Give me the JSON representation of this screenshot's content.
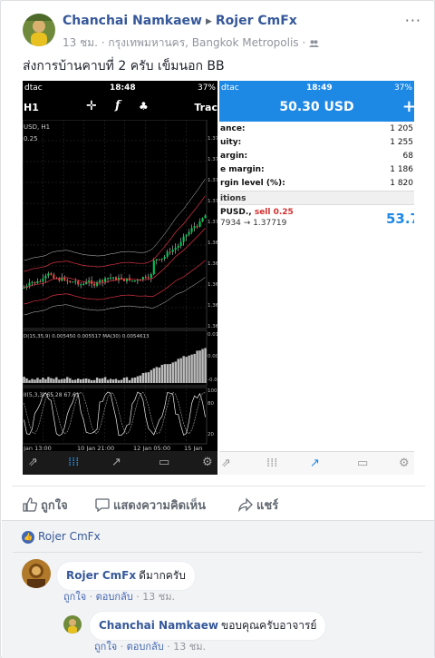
{
  "post": {
    "author": "Chanchai Namkaew",
    "target_group": "Rojer CmFx",
    "time": "13 ชม.",
    "location": "กรุงเทพมหานคร, Bangkok Metropolis",
    "text": "ส่งการบ้านคาบที่ 2 ครับ เข็มนอก BB"
  },
  "left_screenshot": {
    "carrier": "dtac",
    "clock": "18:48",
    "battery": "37%",
    "symbol_label": "USD, H1",
    "price_label": "0.25",
    "timeframe": "H1",
    "trade_label": "Trac",
    "indicator1_label": "D(15,35,9) 0.005450 0.005517 MA(30) 0.0054613",
    "indicator2_label": "II(5,3,3) 65.28 67.61",
    "price_ticks": [
      "1.37",
      "1.37",
      "1.37",
      "1.37",
      "1.37",
      "1.36",
      "1.36",
      "1.36",
      "1.36",
      "1.36"
    ],
    "osc_ticks": [
      "0.01",
      "0.00",
      "-0.00",
      "100",
      "80",
      "20"
    ],
    "time_ticks": [
      "Jan 13:00",
      "10 Jan 21:00",
      "12 Jan 05:00",
      "15 Jan"
    ]
  },
  "right_screenshot": {
    "carrier": "dtac",
    "clock": "18:49",
    "battery": "37%",
    "balance_title": "50.30 USD",
    "account_rows": [
      {
        "label": "ance:",
        "value": "1 205"
      },
      {
        "label": "uity:",
        "value": "1 255"
      },
      {
        "label": "argin:",
        "value": "68"
      },
      {
        "label": "e margin:",
        "value": "1 186"
      },
      {
        "label": "rgin level (%):",
        "value": "1 820"
      }
    ],
    "positions_header": "itions",
    "position_symbol": "PUSD.,",
    "position_side": "sell 0.25",
    "position_prices": "7934 → 1.37719",
    "position_profit": "53.7"
  },
  "actions": {
    "like": "ถูกใจ",
    "comment": "แสดงความคิดเห็น",
    "share": "แชร์"
  },
  "likes": {
    "liker": "Rojer CmFx"
  },
  "comments": [
    {
      "author": "Rojer CmFx",
      "text": "ดีมากครับ",
      "like": "ถูกใจ",
      "reply": "ตอบกลับ",
      "time": "13 ชม."
    },
    {
      "author": "Chanchai Namkaew",
      "text": "ขอบคุณครับอาจารย์",
      "like": "ถูกใจ",
      "reply": "ตอบกลับ",
      "time": "13 ชม."
    }
  ],
  "colors": {
    "link": "#365899",
    "brand_blue": "#1e88e5",
    "bull_candle": "#00c853",
    "bear_candle": "#f44336"
  }
}
